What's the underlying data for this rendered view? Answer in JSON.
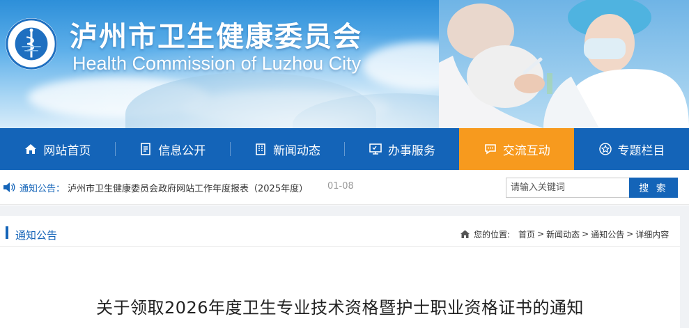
{
  "site": {
    "title_cn": "泸州市卫生健康委员会",
    "title_en": "Health Commission of Luzhou City",
    "logo_ring_text": "泸州市卫生健康委员会"
  },
  "nav": [
    {
      "label": "网站首页",
      "icon": "home-icon",
      "active": false
    },
    {
      "label": "信息公开",
      "icon": "document-list-icon",
      "active": false
    },
    {
      "label": "新闻动态",
      "icon": "building-icon",
      "active": false
    },
    {
      "label": "办事服务",
      "icon": "monitor-icon",
      "active": false
    },
    {
      "label": "交流互动",
      "icon": "chat-icon",
      "active": true
    },
    {
      "label": "专题栏目",
      "icon": "star-icon",
      "active": false
    }
  ],
  "notice": {
    "label": "通知公告：",
    "text": "泸州市卫生健康委员会政府网站工作年度报表（2025年度）",
    "date": "01-08"
  },
  "search": {
    "placeholder": "请输入关键词",
    "button": "搜 索"
  },
  "section": {
    "title": "通知公告"
  },
  "breadcrumb": {
    "label": "您的位置:",
    "items": [
      "首页",
      "新闻动态",
      "通知公告",
      "详细内容"
    ]
  },
  "article": {
    "title": "关于领取2026年度卫生专业技术资格暨护士职业资格证书的通知"
  },
  "colors": {
    "nav_bg": "#1464b8",
    "nav_active": "#f79a1e",
    "accent": "#1464b8"
  }
}
